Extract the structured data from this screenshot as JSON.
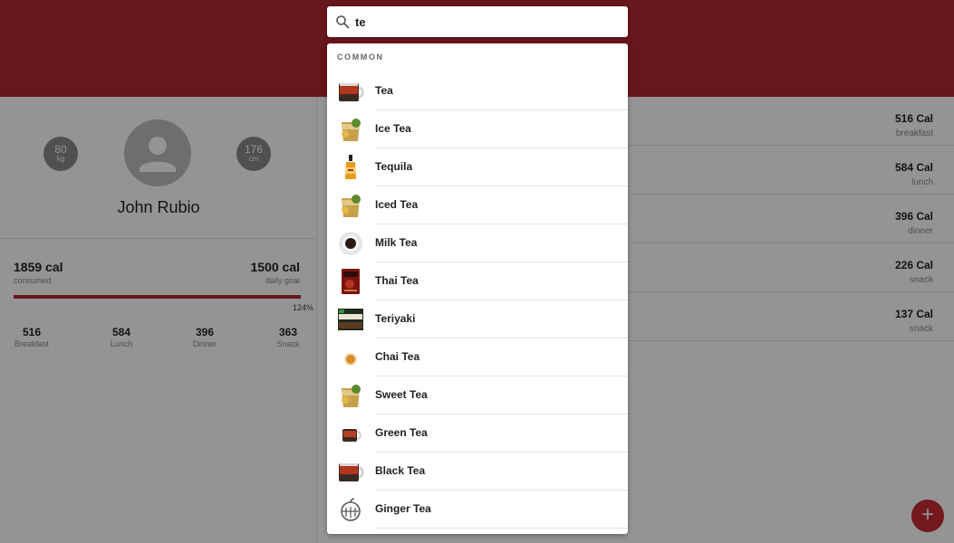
{
  "profile": {
    "name": "John Rubio",
    "weight": {
      "value": "80",
      "unit": "kg"
    },
    "height": {
      "value": "176",
      "unit": "cm"
    }
  },
  "calories": {
    "consumed_value": "1859 cal",
    "consumed_label": "consumed",
    "goal_value": "1500 cal",
    "goal_label": "daily goal",
    "percent_text": "124%",
    "progress_fraction": 1.0
  },
  "meals_summary": [
    {
      "value": "516",
      "label": "Breakfast"
    },
    {
      "value": "584",
      "label": "Lunch"
    },
    {
      "value": "396",
      "label": "Dinner"
    },
    {
      "value": "363",
      "label": "Snack"
    }
  ],
  "meal_list": [
    {
      "cal": "516 Cal",
      "meal": "breakfast"
    },
    {
      "cal": "584 Cal",
      "meal": "lunch"
    },
    {
      "cal": "396 Cal",
      "meal": "dinner"
    },
    {
      "cal": "226 Cal",
      "meal": "snack"
    },
    {
      "cal": "137 Cal",
      "meal": "snack"
    }
  ],
  "search": {
    "value": "te",
    "icon": "search-icon"
  },
  "dropdown": {
    "section_label": "COMMON",
    "items": [
      {
        "label": "Tea",
        "icon": "tea-mug-icon"
      },
      {
        "label": "Ice Tea",
        "icon": "iced-tea-glass-icon"
      },
      {
        "label": "Tequila",
        "icon": "tequila-bottle-icon"
      },
      {
        "label": "Iced Tea",
        "icon": "iced-tea-glass-icon"
      },
      {
        "label": "Milk Tea",
        "icon": "milk-tea-cup-icon"
      },
      {
        "label": "Thai Tea",
        "icon": "thai-tea-package-icon"
      },
      {
        "label": "Teriyaki",
        "icon": "teriyaki-bottle-icon"
      },
      {
        "label": "Chai Tea",
        "icon": "chai-cup-icon"
      },
      {
        "label": "Sweet Tea",
        "icon": "iced-tea-glass-icon"
      },
      {
        "label": "Green Tea",
        "icon": "green-tea-mug-icon"
      },
      {
        "label": "Black Tea",
        "icon": "tea-mug-icon"
      },
      {
        "label": "Ginger Tea",
        "icon": "generic-food-icon"
      }
    ]
  },
  "fab": {
    "symbol": "+"
  },
  "colors": {
    "brand": "#b22630",
    "overlay": "rgba(0,0,0,0.42)"
  }
}
